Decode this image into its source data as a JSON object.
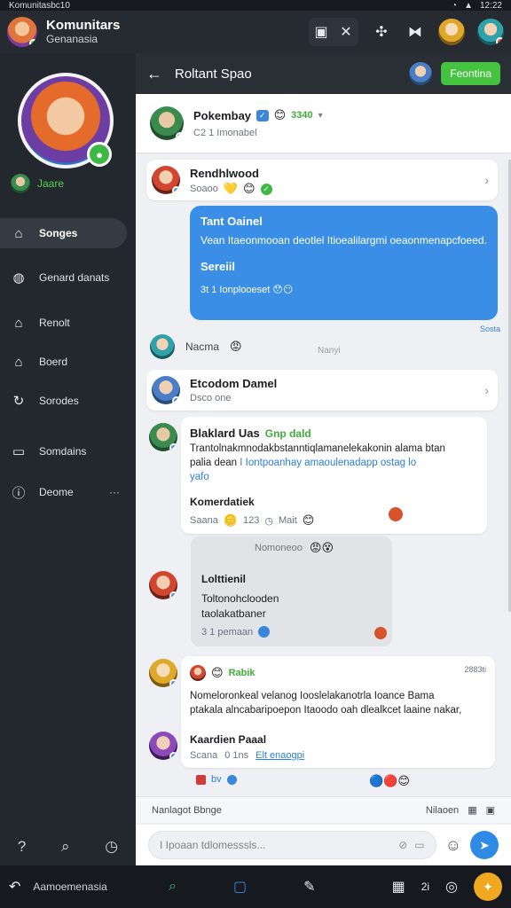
{
  "statusbar": {
    "left": "Komunitasbc10",
    "time": "12:22",
    "wifi_icon": "wifi-icon",
    "battery_icon": "battery-icon"
  },
  "topbar": {
    "title": "Komunitars",
    "subtitle": "Genanasia",
    "accent": "#262a31"
  },
  "sidebar": {
    "status": "Jaare",
    "items": [
      {
        "label": "Songes",
        "icon": "home-icon",
        "active": true
      },
      {
        "label": "Genard danats",
        "icon": "globe-icon",
        "active": false
      },
      {
        "label": "Renolt",
        "icon": "house-icon",
        "active": false
      },
      {
        "label": "Boerd",
        "icon": "building-icon",
        "active": false
      },
      {
        "label": "Sorodes",
        "icon": "refresh-icon",
        "active": false
      },
      {
        "label": "Somdains",
        "icon": "window-icon",
        "active": false
      },
      {
        "label": "Deome",
        "icon": "info-icon",
        "active": false
      }
    ]
  },
  "main": {
    "header_title": "Roltant Spao",
    "join_label": "Feontina",
    "group": {
      "name": "Pokembay",
      "tag": "3340",
      "meta": "C2 1 Imonabel"
    },
    "row1": {
      "name": "Rendhlwood",
      "meta": "Soaoo"
    },
    "bubble": {
      "title": "Tant Oainel",
      "body": "Vean Itaeonmooan deotlel Itioealilargmi oeaonmenapcfoeed.",
      "title2": "Sereiil",
      "meta": "3t 1 Ionplooeset"
    },
    "bubble_time": "Sosta",
    "sender_mid": {
      "name": "Nacma",
      "right": "Nanyi"
    },
    "row2": {
      "name": "Etcodom Damel",
      "meta": "Dsco one"
    },
    "post": {
      "name": "Blaklard Uas",
      "green": "Gnp dald",
      "body1": "Trantolnakmnodakbstanntiqlamanelekakonin alama btan",
      "body2a": "palia dean",
      "body2b": "I Iontpoanhay amaoulenadapp ostag lo",
      "body3": "yafo",
      "name2": "Komerdatiek",
      "meta": "Saana",
      "count": "123",
      "extra": "Mait"
    },
    "gray": {
      "top": "Nomoneoo",
      "name": "Lolttienil",
      "body1": "Toltonohclooden",
      "body2": "taolakatbaner",
      "meta": "3 1 pemaan"
    },
    "post2": {
      "green": "Rabik",
      "time": "2883ti",
      "body1": "Nomeloronkeal velanog Iooslelakanotrla Ioance Bama",
      "body2": "ptakala alncabaripoepon Itaoodo oah dlealkcet laaine nakar,",
      "name": "Kaardien Paaal",
      "meta": "Scana",
      "stat": "0 1ns",
      "link": "Elt enaogpi"
    },
    "composer_label": "Nanlagot Bbnge",
    "composer_right": "Nilaoen",
    "composer_placeholder": "I Ipoaan tdlomesssls..."
  },
  "navbar": {
    "label": "Aamoemenasia",
    "time": "2i"
  }
}
